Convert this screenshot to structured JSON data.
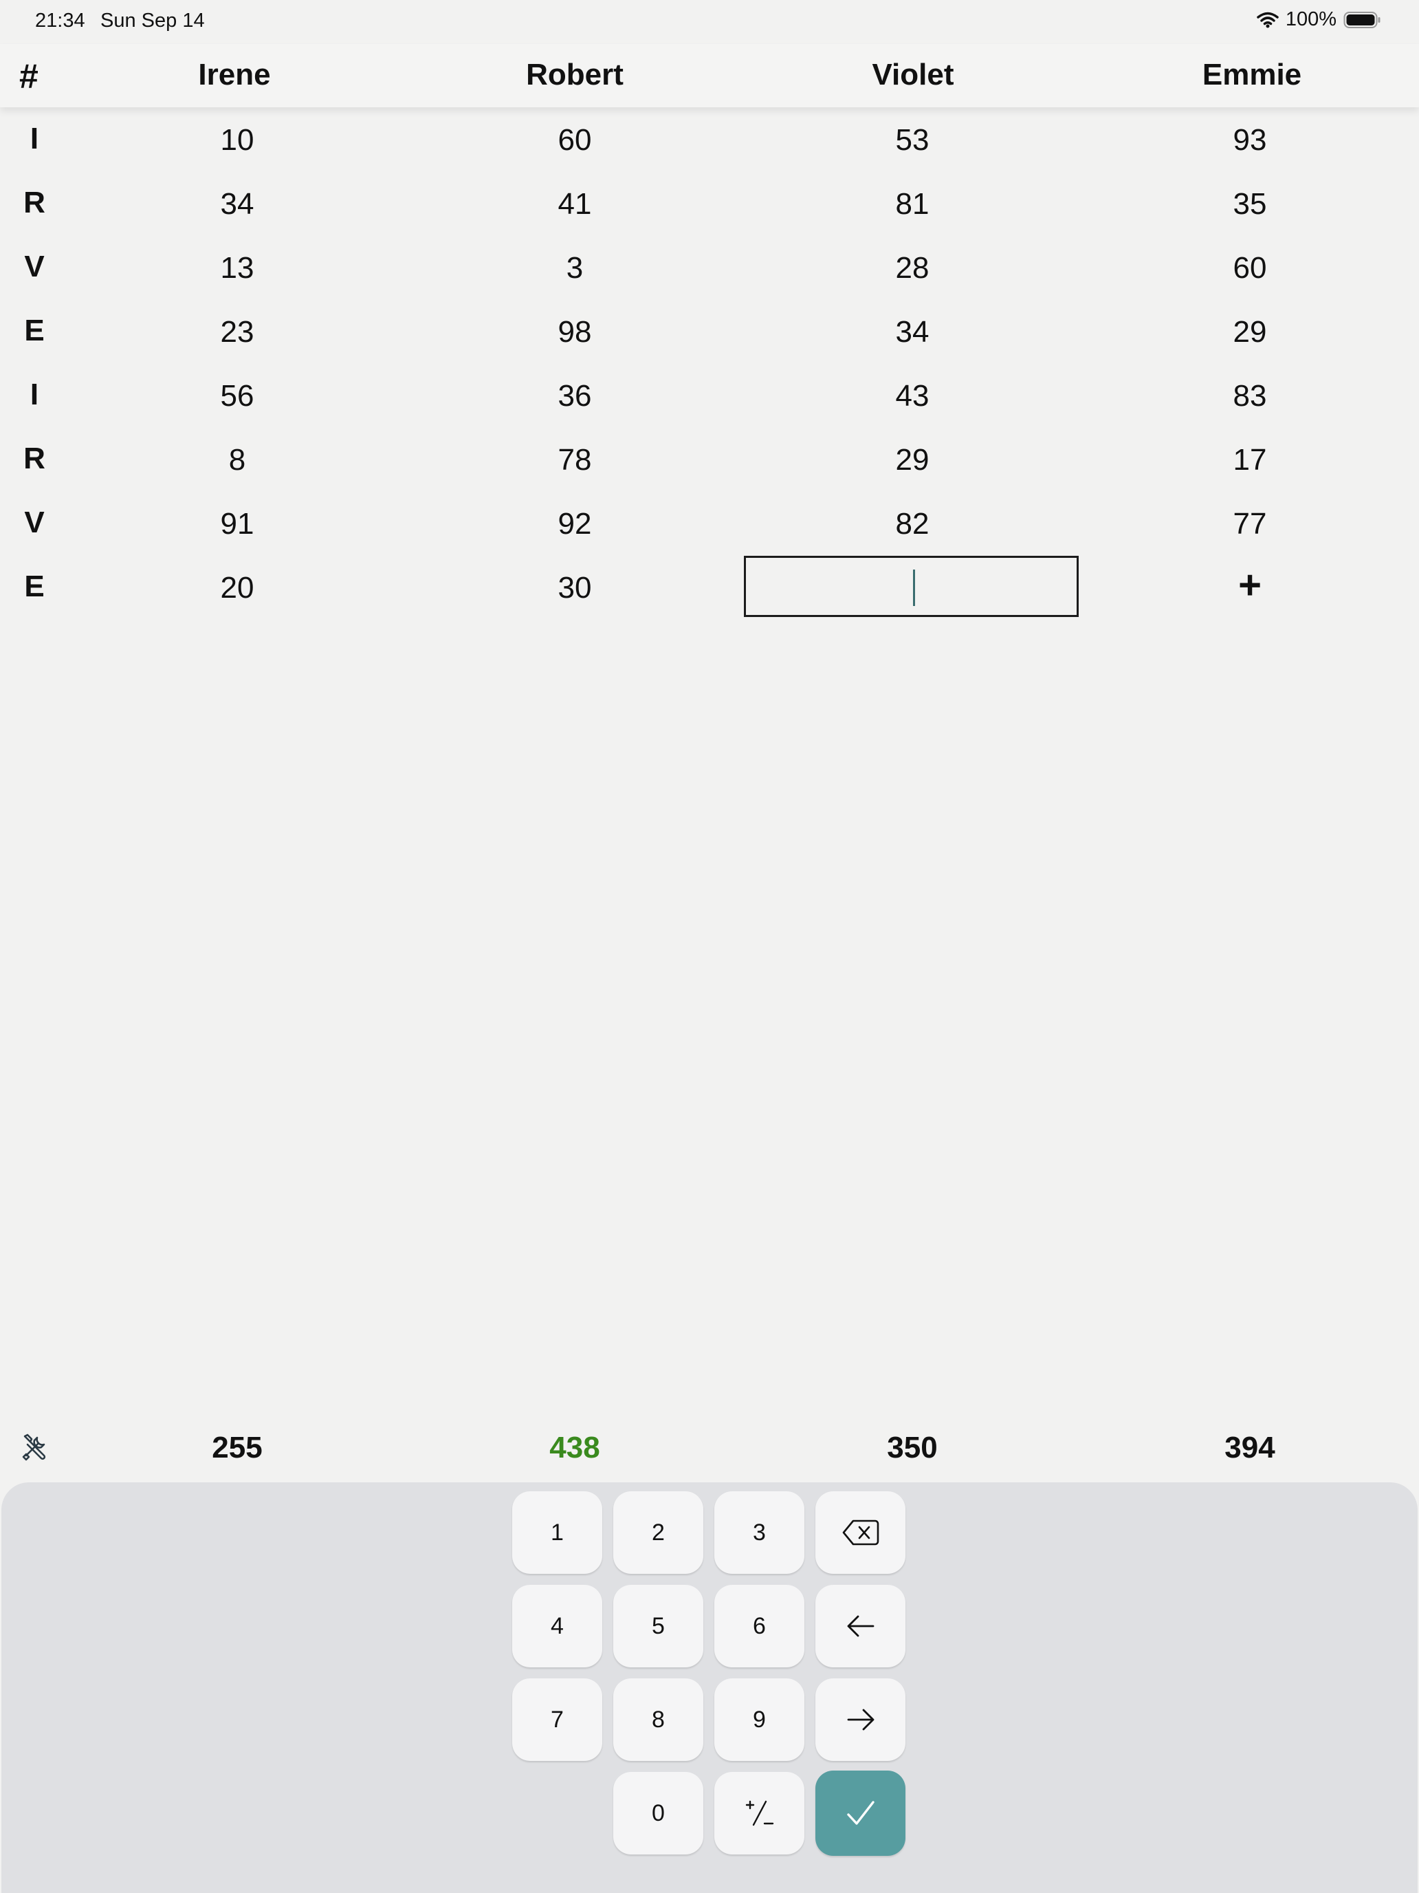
{
  "status_bar": {
    "time": "21:34",
    "date": "Sun Sep 14",
    "battery": "100%"
  },
  "header": {
    "row_symbol": "#",
    "players": [
      "Irene",
      "Robert",
      "Violet",
      "Emmie"
    ]
  },
  "rows": [
    {
      "label": "I",
      "scores": [
        "10",
        "60",
        "53",
        "93"
      ]
    },
    {
      "label": "R",
      "scores": [
        "34",
        "41",
        "81",
        "35"
      ]
    },
    {
      "label": "V",
      "scores": [
        "13",
        "3",
        "28",
        "60"
      ]
    },
    {
      "label": "E",
      "scores": [
        "23",
        "98",
        "34",
        "29"
      ]
    },
    {
      "label": "I",
      "scores": [
        "56",
        "36",
        "43",
        "83"
      ]
    },
    {
      "label": "R",
      "scores": [
        "8",
        "78",
        "29",
        "17"
      ]
    },
    {
      "label": "V",
      "scores": [
        "91",
        "92",
        "82",
        "77"
      ]
    },
    {
      "label": "E",
      "scores": [
        "20",
        "30"
      ]
    }
  ],
  "add_button": "+",
  "totals": {
    "values": [
      "255",
      "438",
      "350",
      "394"
    ],
    "leader_color": "#3a8a1e",
    "default_color": "#111111"
  },
  "keypad": {
    "digits": [
      "1",
      "2",
      "3",
      "4",
      "5",
      "6",
      "7",
      "8",
      "9",
      "0"
    ],
    "sign_key": "+/−",
    "icons": [
      "backspace-icon",
      "arrow-left-icon",
      "arrow-right-icon",
      "checkmark-icon"
    ],
    "confirm_color": "#579da0"
  }
}
